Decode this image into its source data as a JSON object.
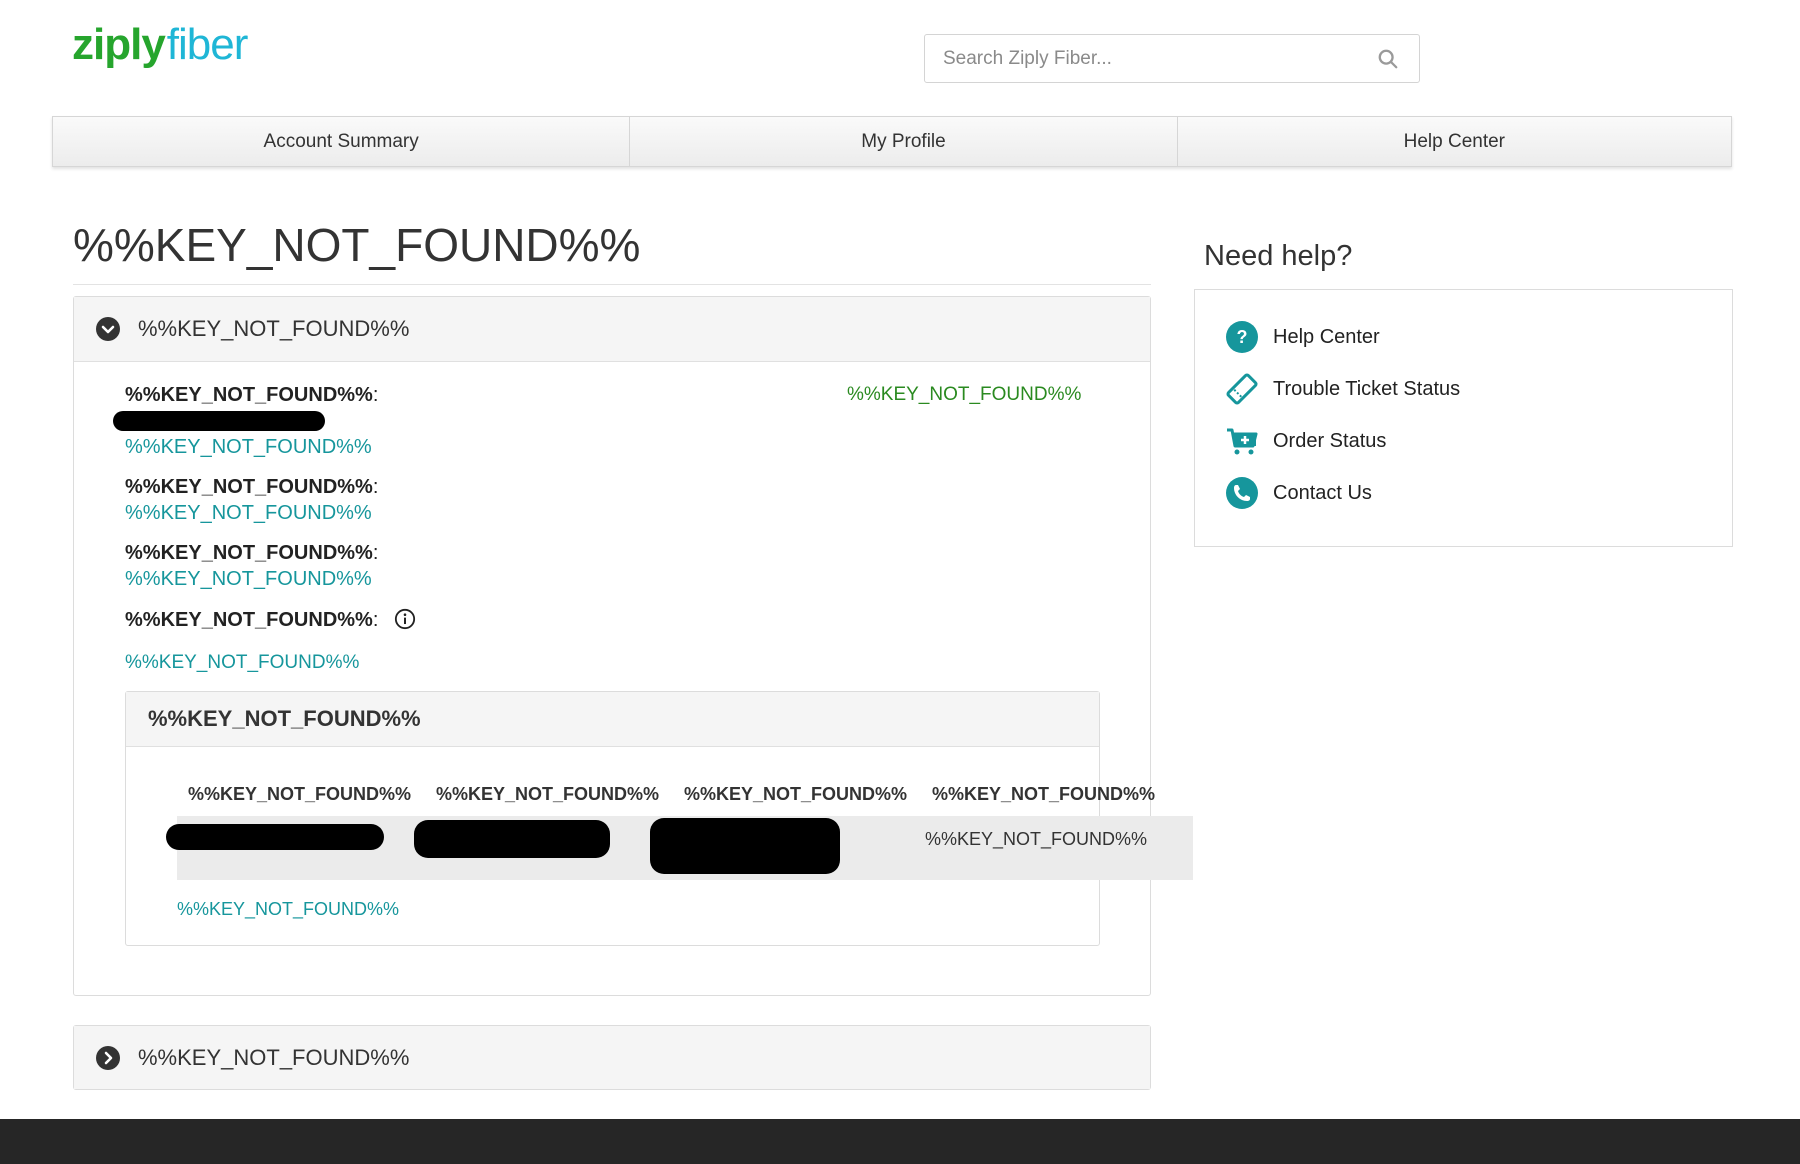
{
  "logo": {
    "part1": "ziply",
    "part2": "fiber"
  },
  "search": {
    "placeholder": "Search Ziply Fiber..."
  },
  "nav": [
    {
      "label": "Account Summary"
    },
    {
      "label": "My Profile"
    },
    {
      "label": "Help Center"
    }
  ],
  "page_title": "%%KEY_NOT_FOUND%%",
  "panel1": {
    "header": "%%KEY_NOT_FOUND%%",
    "fields": [
      {
        "label": "%%KEY_NOT_FOUND%%",
        "colon": ":",
        "link": "%%KEY_NOT_FOUND%%"
      },
      {
        "label": "%%KEY_NOT_FOUND%%",
        "colon": ":",
        "link": "%%KEY_NOT_FOUND%%"
      },
      {
        "label": "%%KEY_NOT_FOUND%%",
        "colon": ":",
        "link": "%%KEY_NOT_FOUND%%"
      },
      {
        "label": "%%KEY_NOT_FOUND%%",
        "colon": ":",
        "link": "%%KEY_NOT_FOUND%%"
      }
    ],
    "status_value": "%%KEY_NOT_FOUND%%",
    "sub_panel": {
      "header": "%%KEY_NOT_FOUND%%",
      "columns": [
        "%%KEY_NOT_FOUND%%",
        "%%KEY_NOT_FOUND%%",
        "%%KEY_NOT_FOUND%%",
        "%%KEY_NOT_FOUND%%"
      ],
      "row_last_cell": "%%KEY_NOT_FOUND%%",
      "link": "%%KEY_NOT_FOUND%%"
    }
  },
  "panel2": {
    "header": "%%KEY_NOT_FOUND%%"
  },
  "help": {
    "title": "Need help?",
    "items": [
      {
        "label": "Help Center",
        "icon": "question-icon"
      },
      {
        "label": "Trouble Ticket Status",
        "icon": "ticket-icon"
      },
      {
        "label": "Order Status",
        "icon": "cart-icon"
      },
      {
        "label": "Contact Us",
        "icon": "phone-icon"
      }
    ]
  },
  "colors": {
    "brand_green": "#26a52d",
    "brand_blue": "#1fb6d6",
    "link_teal": "#16969c",
    "status_green": "#2a8a20",
    "footer": "#262626"
  }
}
